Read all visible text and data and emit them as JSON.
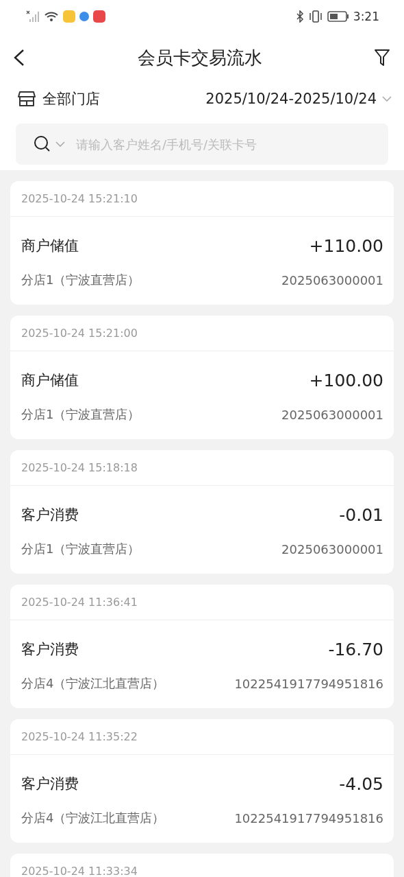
{
  "status_bar": {
    "time": "3:21"
  },
  "header": {
    "title": "会员卡交易流水"
  },
  "filters": {
    "store": "全部门店",
    "date_range": "2025/10/24-2025/10/24"
  },
  "search": {
    "placeholder": "请输入客户姓名/手机号/关联卡号"
  },
  "transactions": [
    {
      "time": "2025-10-24 15:21:10",
      "type": "商户储值",
      "amount": "+110.00",
      "store": "分店1（宁波直营店）",
      "card_no": "2025063000001"
    },
    {
      "time": "2025-10-24 15:21:00",
      "type": "商户储值",
      "amount": "+100.00",
      "store": "分店1（宁波直营店）",
      "card_no": "2025063000001"
    },
    {
      "time": "2025-10-24 15:18:18",
      "type": "客户消费",
      "amount": "-0.01",
      "store": "分店1（宁波直营店）",
      "card_no": "2025063000001"
    },
    {
      "time": "2025-10-24 11:36:41",
      "type": "客户消费",
      "amount": "-16.70",
      "store": "分店4（宁波江北直营店）",
      "card_no": "1022541917794951816"
    },
    {
      "time": "2025-10-24 11:35:22",
      "type": "客户消费",
      "amount": "-4.05",
      "store": "分店4（宁波江北直营店）",
      "card_no": "1022541917794951816"
    },
    {
      "time": "2025-10-24 11:33:34"
    }
  ]
}
